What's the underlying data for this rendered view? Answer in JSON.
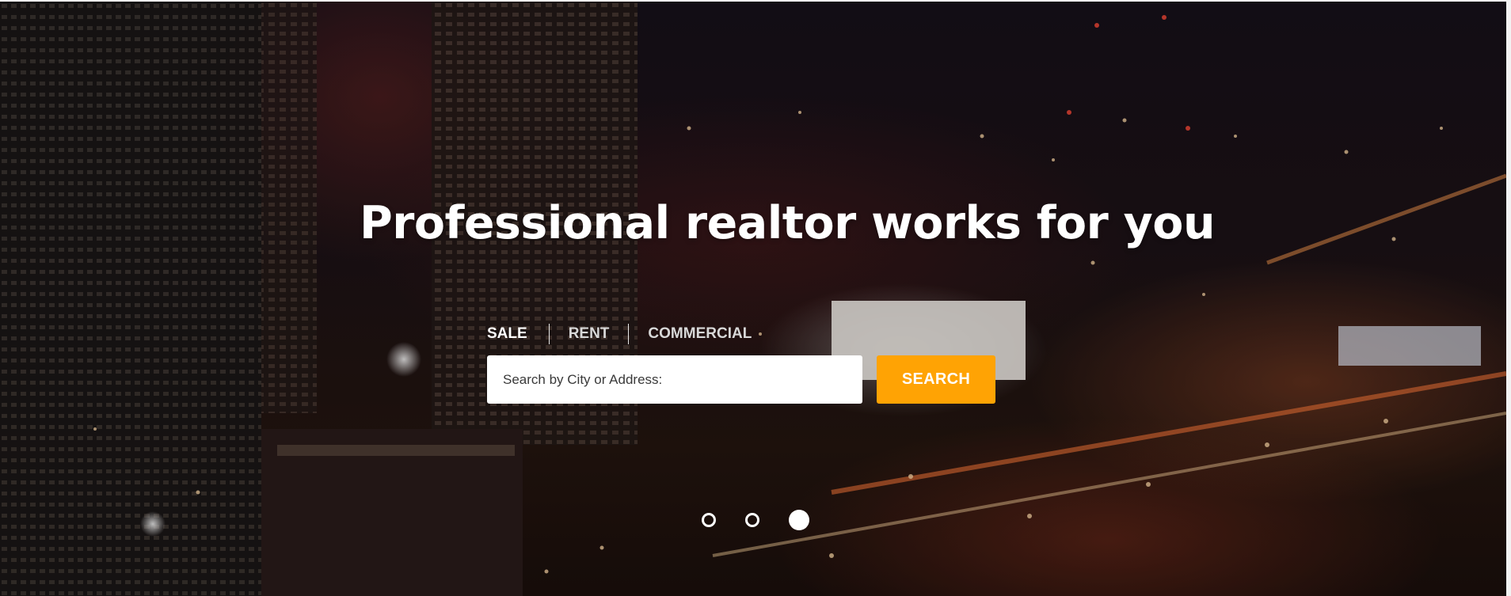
{
  "hero": {
    "headline": "Professional realtor works for you",
    "background": "night-city-skyline-photo"
  },
  "search": {
    "tabs": [
      {
        "label": "SALE",
        "active": true
      },
      {
        "label": "RENT",
        "active": false
      },
      {
        "label": "COMMERCIAL",
        "active": false
      }
    ],
    "placeholder": "Search by City or Address:",
    "value": "",
    "button_label": "SEARCH"
  },
  "slider": {
    "slide_count": 3,
    "active_slide": 3
  },
  "colors": {
    "accent": "#ffa304",
    "text": "#ffffff"
  }
}
